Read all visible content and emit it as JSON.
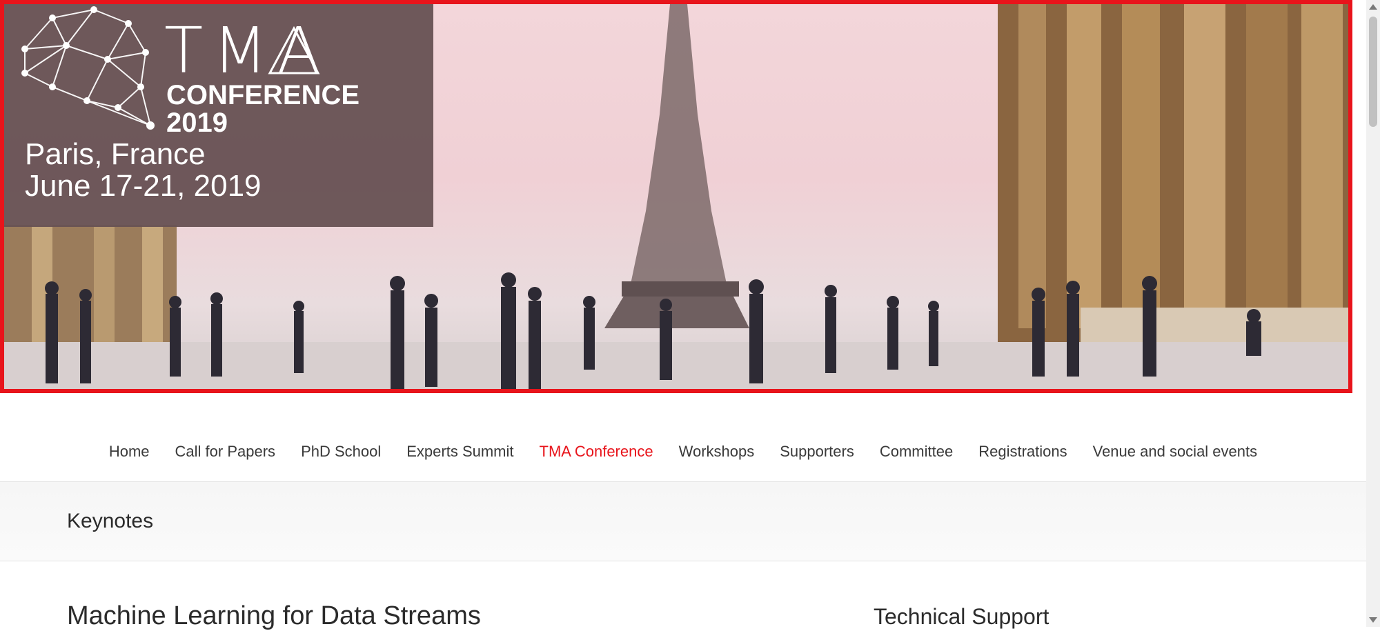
{
  "hero": {
    "logo_title": "TMA",
    "logo_subtitle": "CONFERENCE",
    "logo_year": "2019",
    "city": "Paris, France",
    "dates": "June 17-21, 2019",
    "border_color": "#e8141b"
  },
  "nav": {
    "items": [
      {
        "label": "Home",
        "active": false
      },
      {
        "label": "Call for Papers",
        "active": false
      },
      {
        "label": "PhD School",
        "active": false
      },
      {
        "label": "Experts Summit",
        "active": false
      },
      {
        "label": "TMA Conference",
        "active": true
      },
      {
        "label": "Workshops",
        "active": false
      },
      {
        "label": "Supporters",
        "active": false
      },
      {
        "label": "Committee",
        "active": false
      },
      {
        "label": "Registrations",
        "active": false
      },
      {
        "label": "Venue and social events",
        "active": false
      }
    ],
    "active_color": "#e8141b"
  },
  "page": {
    "title": "Keynotes"
  },
  "content": {
    "main_heading": "Machine Learning for Data Streams",
    "sidebar_heading": "Technical Support"
  }
}
